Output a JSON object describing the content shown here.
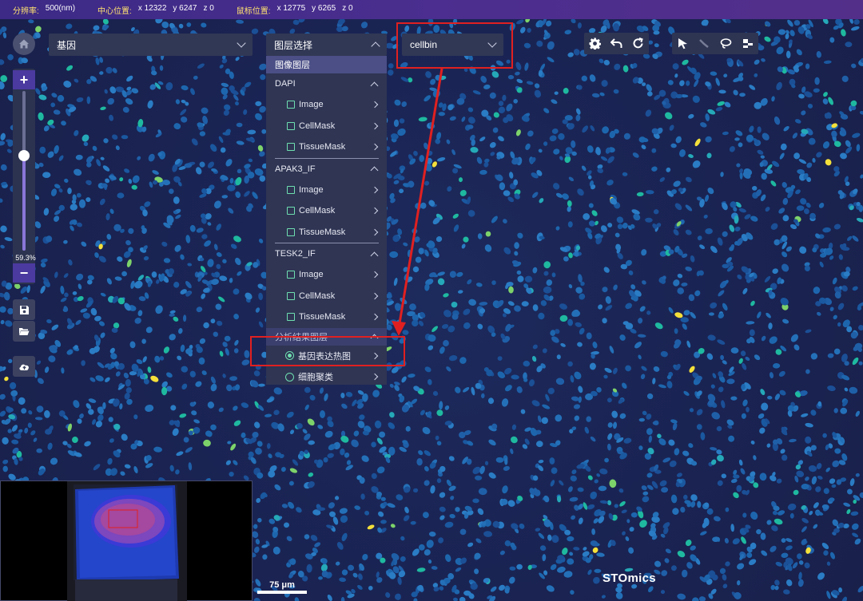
{
  "status_bar": {
    "resolution_label": "分辨率:",
    "resolution_value": "500(nm)",
    "center_label": "中心位置:",
    "center_x": "x 12322",
    "center_y": "y 6247",
    "center_z": "z 0",
    "mouse_label": "鼠标位置:",
    "mouse_x": "x 12775",
    "mouse_y": "y 6265",
    "mouse_z": "z 0"
  },
  "gene_select": {
    "value": "基因"
  },
  "layer_select": {
    "label": "图层选择"
  },
  "cellbin_select": {
    "value": "cellbin"
  },
  "layer_menu": {
    "section_title": "图像图层",
    "groups": [
      {
        "name": "DAPI",
        "items": [
          "Image",
          "CellMask",
          "TissueMask"
        ]
      },
      {
        "name": "APAK3_IF",
        "items": [
          "Image",
          "CellMask",
          "TissueMask"
        ]
      },
      {
        "name": "TESK2_IF",
        "items": [
          "Image",
          "CellMask",
          "TissueMask"
        ]
      }
    ],
    "analysis_title": "分析结果图层",
    "analysis_items": [
      "基因表达热图",
      "细胞聚类"
    ],
    "analysis_selected": 0
  },
  "zoom": {
    "level_text": "59.3%",
    "level": 0.593
  },
  "scalebar": {
    "label": "75 μm"
  },
  "brand": {
    "text": "STOmics"
  },
  "icons": {
    "home": "home-icon",
    "save": "save-icon",
    "folder": "folder-open-icon",
    "cloud": "cloud-upload-icon",
    "settings": "gear-icon",
    "undo": "undo-icon",
    "redo": "redo-icon",
    "select": "cursor-icon",
    "line": "line-tool-icon",
    "lasso": "lasso-icon",
    "layout": "layout-icon"
  },
  "colors": {
    "accent": "#4b3aa0",
    "highlight": "#e02020",
    "cell_low": "#1f5fa8",
    "cell_mid": "#1fb9a0",
    "cell_high": "#f4e03a"
  }
}
